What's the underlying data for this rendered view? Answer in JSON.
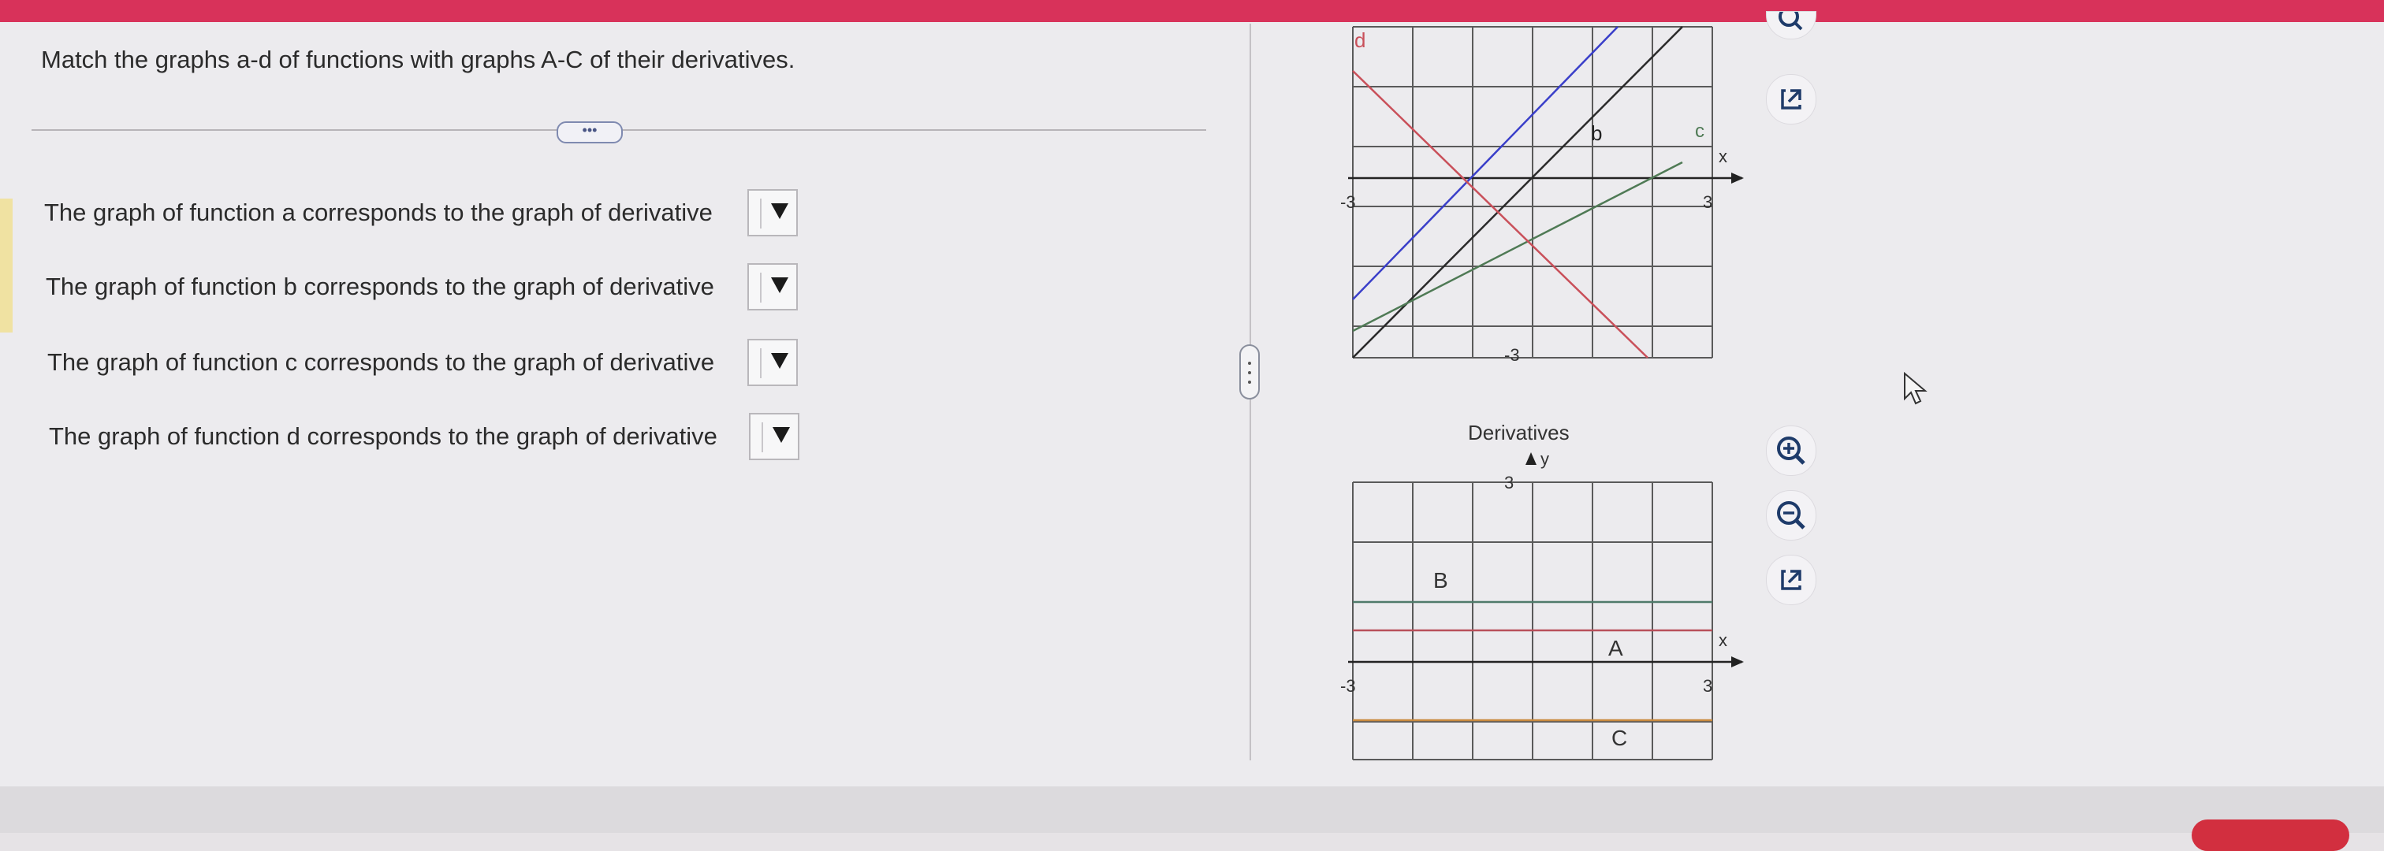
{
  "instruction": "Match the graphs a-d of functions with graphs A-C of their derivatives.",
  "more_label": "•••",
  "questions": [
    {
      "text": "The graph of function a corresponds to the graph of derivative",
      "selected": ""
    },
    {
      "text": "The graph of function b corresponds to the graph of derivative",
      "selected": ""
    },
    {
      "text": "The graph of function c corresponds to the graph of derivative",
      "selected": ""
    },
    {
      "text": "The graph of function d corresponds to the graph of derivative",
      "selected": ""
    }
  ],
  "functions_graph": {
    "axis_x_label": "x",
    "tick_neg_x": "-3",
    "tick_pos_x": "3",
    "tick_neg_y": "-3",
    "line_labels": {
      "d": "d",
      "b": "b",
      "c": "c"
    },
    "colors": {
      "a": "#3a3fc9",
      "b": "#2a2a2a",
      "c": "#4f7a55",
      "d": "#c9505a",
      "grid": "#5a5a5a"
    }
  },
  "derivatives_graph": {
    "title": "Derivatives",
    "axis_x_label": "x",
    "axis_y_label": "y",
    "tick_pos_y": "3",
    "tick_neg_x": "-3",
    "tick_pos_x": "3",
    "line_labels": {
      "A": "A",
      "B": "B",
      "C": "C"
    },
    "colors": {
      "A": "#b8505a",
      "B": "#4f7a6a",
      "C": "#c98a3e",
      "grid": "#5a5a5a"
    }
  },
  "icons": [
    "zoom-out-icon",
    "external-link-icon",
    "zoom-in-icon",
    "zoom-out-icon",
    "external-link-icon"
  ]
}
